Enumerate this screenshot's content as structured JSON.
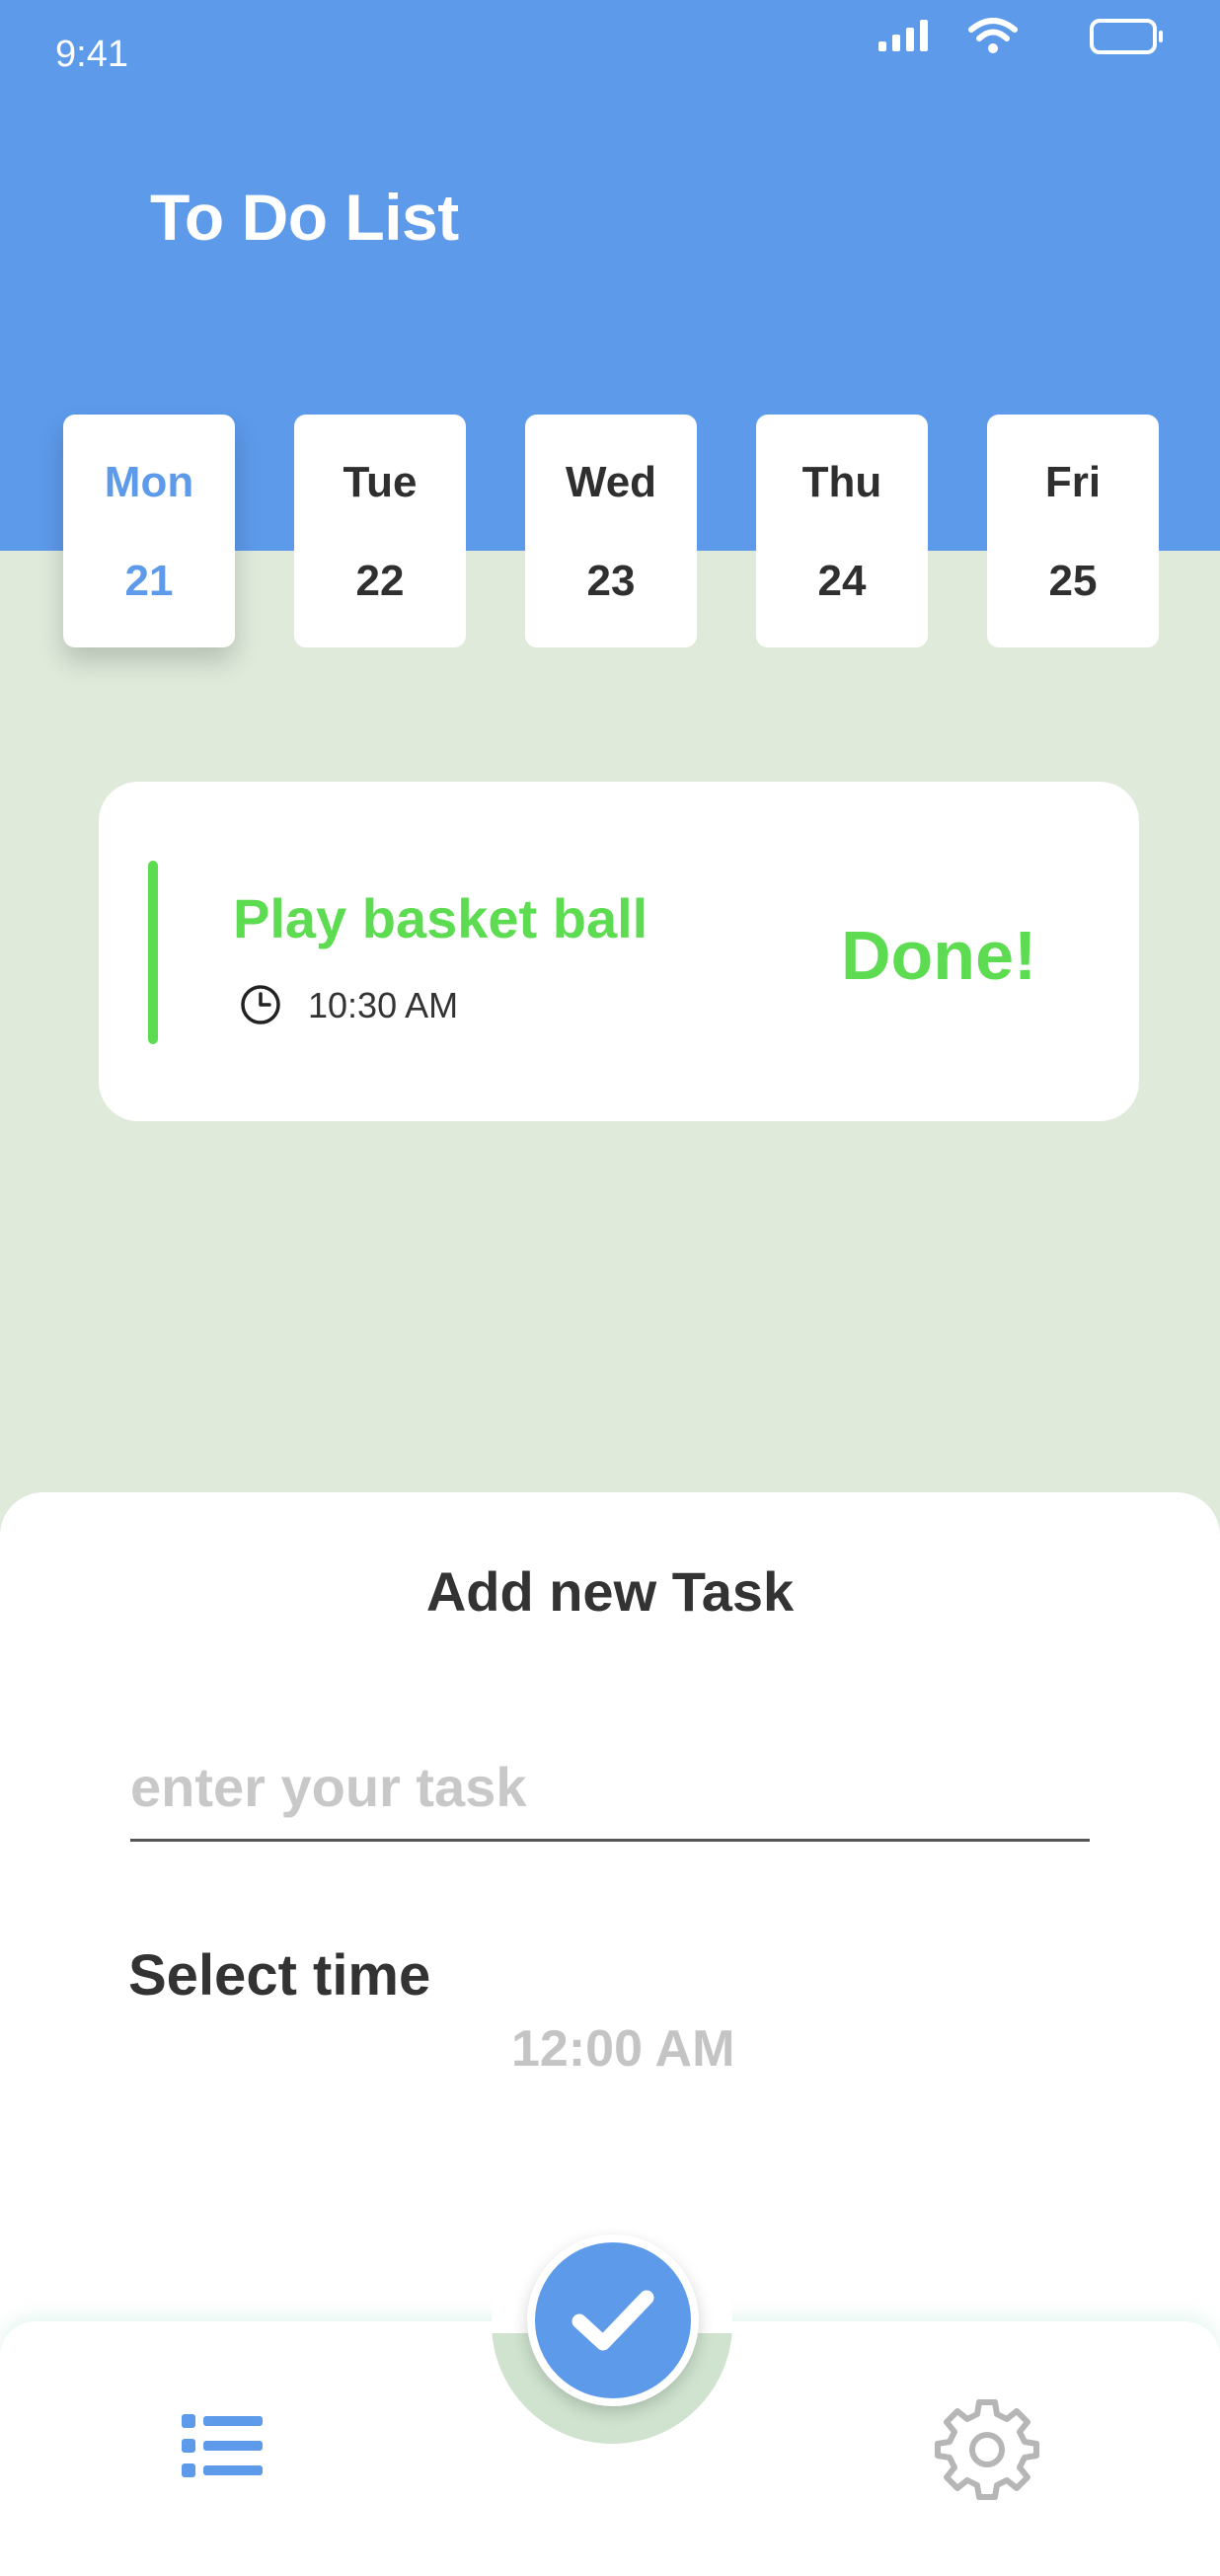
{
  "status_bar": {
    "time": "9:41"
  },
  "app": {
    "title": "To Do List"
  },
  "days": [
    {
      "name": "Mon",
      "date": "21",
      "active": true
    },
    {
      "name": "Tue",
      "date": "22",
      "active": false
    },
    {
      "name": "Wed",
      "date": "23",
      "active": false
    },
    {
      "name": "Thu",
      "date": "24",
      "active": false
    },
    {
      "name": "Fri",
      "date": "25",
      "active": false
    }
  ],
  "tasks": [
    {
      "title": "Play basket ball",
      "time": "10:30 AM",
      "status": "Done!"
    }
  ],
  "new_task": {
    "heading": "Add new Task",
    "input_value": "",
    "input_placeholder": "enter your task",
    "time_label": "Select time",
    "time_value": "12:00 AM"
  },
  "icons": {
    "signal": "signal-icon",
    "wifi": "wifi-icon",
    "battery": "battery-icon",
    "clock": "clock-icon",
    "confirm": "check-icon",
    "list": "list-icon",
    "settings": "gear-icon"
  },
  "colors": {
    "primary": "#5d9aea",
    "background": "#dfeadb",
    "done": "#5ddc52",
    "text": "#333333",
    "muted": "#c4c4c4"
  }
}
